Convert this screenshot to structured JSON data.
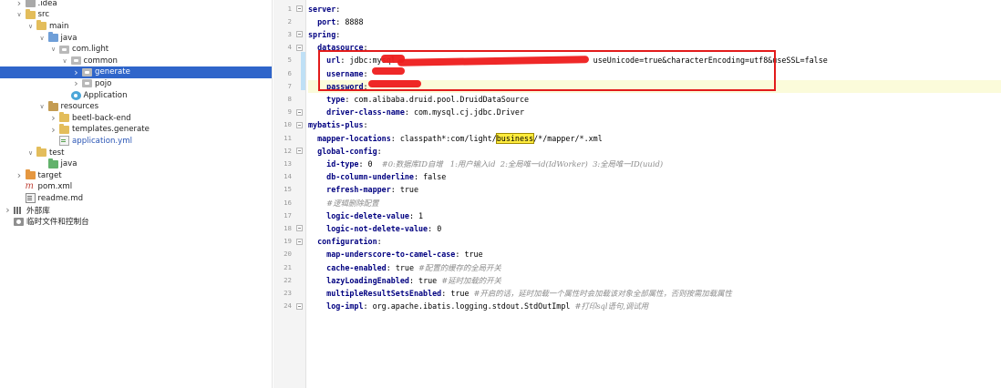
{
  "tree": [
    {
      "label": ".idea",
      "depth": 1,
      "arrow": "right",
      "icon": "folder-idea",
      "name": "idea"
    },
    {
      "label": "src",
      "depth": 1,
      "arrow": "down",
      "icon": "folder",
      "name": "src"
    },
    {
      "label": "main",
      "depth": 2,
      "arrow": "down",
      "icon": "folder",
      "name": "main"
    },
    {
      "label": "java",
      "depth": 3,
      "arrow": "down",
      "icon": "folder-src",
      "name": "java"
    },
    {
      "label": "com.light",
      "depth": 4,
      "arrow": "down",
      "icon": "package",
      "name": "com-light"
    },
    {
      "label": "common",
      "depth": 5,
      "arrow": "down",
      "icon": "package",
      "name": "common"
    },
    {
      "label": "generate",
      "depth": 6,
      "arrow": "right",
      "icon": "package",
      "name": "generate",
      "selected": true
    },
    {
      "label": "pojo",
      "depth": 6,
      "arrow": "right",
      "icon": "package",
      "name": "pojo"
    },
    {
      "label": "Application",
      "depth": 5,
      "arrow": "",
      "icon": "class",
      "name": "application-class"
    },
    {
      "label": "resources",
      "depth": 3,
      "arrow": "down",
      "icon": "folder-res",
      "name": "resources"
    },
    {
      "label": "beetl-back-end",
      "depth": 4,
      "arrow": "right",
      "icon": "folder",
      "name": "beetl-back-end"
    },
    {
      "label": "templates.generate",
      "depth": 4,
      "arrow": "right",
      "icon": "folder",
      "name": "templates-generate"
    },
    {
      "label": "application.yml",
      "depth": 4,
      "arrow": "",
      "icon": "yml",
      "name": "application-yml",
      "color": "blue"
    },
    {
      "label": "test",
      "depth": 2,
      "arrow": "down",
      "icon": "folder",
      "name": "test"
    },
    {
      "label": "java",
      "depth": 3,
      "arrow": "",
      "icon": "folder-test",
      "name": "test-java"
    },
    {
      "label": "target",
      "depth": 1,
      "arrow": "right",
      "icon": "folder-target",
      "name": "target"
    },
    {
      "label": "pom.xml",
      "depth": 1,
      "arrow": "",
      "icon": "maven",
      "name": "pom-xml"
    },
    {
      "label": "readme.md",
      "depth": 1,
      "arrow": "",
      "icon": "md",
      "name": "readme-md"
    },
    {
      "label": "外部库",
      "depth": 0,
      "arrow": "right",
      "icon": "library",
      "name": "external-libraries"
    },
    {
      "label": "临时文件和控制台",
      "depth": 0,
      "arrow": "",
      "icon": "scratch",
      "name": "scratches-consoles"
    }
  ],
  "editor": {
    "lines": [
      {
        "n": "1",
        "fold": true,
        "segs": [
          [
            "k",
            "server"
          ],
          [
            "",
            ":"
          ]
        ]
      },
      {
        "n": "2",
        "segs": [
          [
            "",
            "  "
          ],
          [
            "k",
            "port"
          ],
          [
            "",
            ": 8888"
          ]
        ]
      },
      {
        "n": "3",
        "fold": true,
        "segs": [
          [
            "k",
            "spring"
          ],
          [
            "",
            ":"
          ]
        ]
      },
      {
        "n": "4",
        "fold": true,
        "segs": [
          [
            "",
            "  "
          ],
          [
            "k",
            "datasource"
          ],
          [
            "",
            ":"
          ]
        ]
      },
      {
        "n": "5",
        "segs": [
          [
            "",
            "    "
          ],
          [
            "k",
            "url"
          ],
          [
            "",
            ": jdbc:mysql"
          ],
          [
            "",
            "                                           "
          ],
          [
            "",
            "useUnicode=true&characterEncoding=utf8&useSSL=false"
          ]
        ]
      },
      {
        "n": "6",
        "segs": [
          [
            "",
            "    "
          ],
          [
            "k",
            "username"
          ],
          [
            "",
            ":"
          ]
        ]
      },
      {
        "n": "7",
        "hl": true,
        "segs": [
          [
            "",
            "    "
          ],
          [
            "k",
            "password"
          ],
          [
            "",
            ":"
          ]
        ]
      },
      {
        "n": "8",
        "segs": [
          [
            "",
            "    "
          ],
          [
            "k",
            "type"
          ],
          [
            "",
            ": com.alibaba.druid.pool.DruidDataSource"
          ]
        ]
      },
      {
        "n": "9",
        "fold": true,
        "segs": [
          [
            "",
            "    "
          ],
          [
            "k",
            "driver-class-name"
          ],
          [
            "",
            ": com.mysql.cj.jdbc.Driver"
          ]
        ]
      },
      {
        "n": "10",
        "fold": true,
        "segs": [
          [
            "k",
            "mybatis-plus"
          ],
          [
            "",
            ":"
          ]
        ]
      },
      {
        "n": "11",
        "segs": [
          [
            "",
            "  "
          ],
          [
            "k",
            "mapper-locations"
          ],
          [
            "",
            ": classpath*:com/light/"
          ],
          [
            "m",
            "business"
          ],
          [
            "",
            "/*/mapper/*.xml"
          ]
        ]
      },
      {
        "n": "12",
        "fold": true,
        "segs": [
          [
            "",
            "  "
          ],
          [
            "k",
            "global-config"
          ],
          [
            "",
            ":"
          ]
        ]
      },
      {
        "n": "13",
        "segs": [
          [
            "",
            "    "
          ],
          [
            "k",
            "id-type"
          ],
          [
            "",
            ": 0  "
          ],
          [
            "c",
            "#0:数据库ID自增   1:用户输入id  2:全局唯一id(IdWorker)  3:全局唯一ID(uuid)"
          ]
        ]
      },
      {
        "n": "14",
        "segs": [
          [
            "",
            "    "
          ],
          [
            "k",
            "db-column-underline"
          ],
          [
            "",
            ": false"
          ]
        ]
      },
      {
        "n": "15",
        "segs": [
          [
            "",
            "    "
          ],
          [
            "k",
            "refresh-mapper"
          ],
          [
            "",
            ": true"
          ]
        ]
      },
      {
        "n": "16",
        "segs": [
          [
            "",
            "    "
          ],
          [
            "c",
            "#逻辑删除配置"
          ]
        ]
      },
      {
        "n": "17",
        "segs": [
          [
            "",
            "    "
          ],
          [
            "k",
            "logic-delete-value"
          ],
          [
            "",
            ": 1"
          ]
        ]
      },
      {
        "n": "18",
        "fold": true,
        "segs": [
          [
            "",
            "    "
          ],
          [
            "k",
            "logic-not-delete-value"
          ],
          [
            "",
            ": 0"
          ]
        ]
      },
      {
        "n": "19",
        "fold": true,
        "segs": [
          [
            "",
            "  "
          ],
          [
            "k",
            "configuration"
          ],
          [
            "",
            ":"
          ]
        ]
      },
      {
        "n": "20",
        "segs": [
          [
            "",
            "    "
          ],
          [
            "k",
            "map-underscore-to-camel-case"
          ],
          [
            "",
            ": true"
          ]
        ]
      },
      {
        "n": "21",
        "segs": [
          [
            "",
            "    "
          ],
          [
            "k",
            "cache-enabled"
          ],
          [
            "",
            ": true "
          ],
          [
            "c",
            "#配置的缓存的全局开关"
          ]
        ]
      },
      {
        "n": "22",
        "segs": [
          [
            "",
            "    "
          ],
          [
            "k",
            "lazyLoadingEnabled"
          ],
          [
            "",
            ": true "
          ],
          [
            "c",
            "#延时加载的开关"
          ]
        ]
      },
      {
        "n": "23",
        "segs": [
          [
            "",
            "    "
          ],
          [
            "k",
            "multipleResultSetsEnabled"
          ],
          [
            "",
            ": true "
          ],
          [
            "c",
            "#开启的话，延时加载一个属性时会加载该对象全部属性，否则按需加载属性"
          ]
        ]
      },
      {
        "n": "24",
        "fold": true,
        "segs": [
          [
            "",
            "    "
          ],
          [
            "k",
            "log-impl"
          ],
          [
            "",
            ": org.apache.ibatis.logging.stdout.StdOutImpl "
          ],
          [
            "c",
            "#打印sql语句,调试用"
          ]
        ]
      }
    ]
  },
  "colors": {
    "selection": "#2f65ca",
    "annotation": "#e21b1b",
    "keyword": "#000080",
    "comment": "#8c8c8c",
    "caret_line": "#fbfbda"
  }
}
